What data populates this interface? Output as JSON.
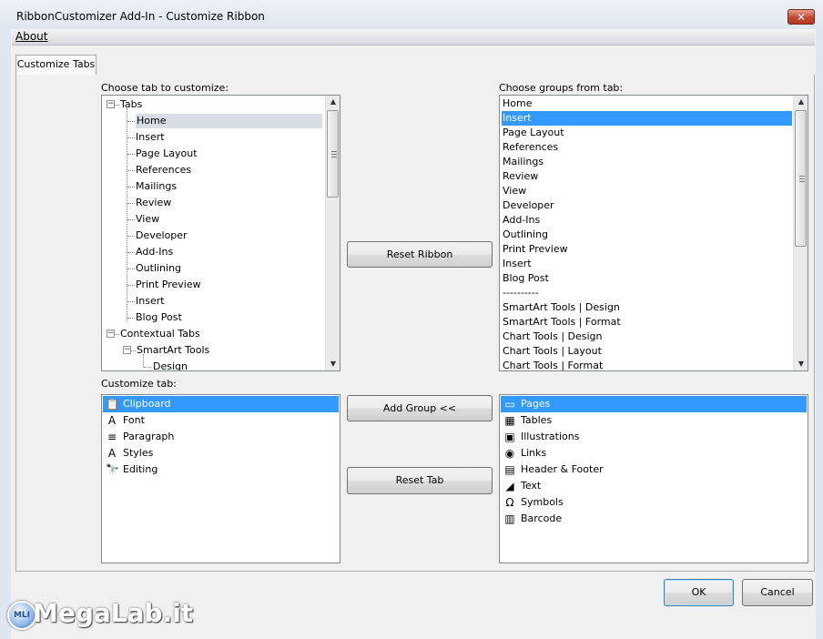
{
  "window": {
    "title": "RibbonCustomizer Add-In - Customize Ribbon",
    "close_glyph": "✕"
  },
  "menu": {
    "about": "About"
  },
  "tab": {
    "label": "Customize Tabs"
  },
  "labels": {
    "choose_tab": "Choose tab to customize:",
    "choose_groups": "Choose groups from tab:",
    "customize_tab": "Customize tab:"
  },
  "tree": {
    "root": "Tabs",
    "tabs": [
      "Home",
      "Insert",
      "Page Layout",
      "References",
      "Mailings",
      "Review",
      "View",
      "Developer",
      "Add-Ins",
      "Outlining",
      "Print Preview",
      "Insert",
      "Blog Post"
    ],
    "contextual": "Contextual Tabs",
    "smartart": "SmartArt Tools",
    "design": "Design",
    "selected": "Home"
  },
  "groups_from_tab": {
    "items": [
      "Home",
      "Insert",
      "Page Layout",
      "References",
      "Mailings",
      "Review",
      "View",
      "Developer",
      "Add-Ins",
      "Outlining",
      "Print Preview",
      "Insert",
      "Blog Post",
      "----------",
      "SmartArt Tools | Design",
      "SmartArt Tools | Format",
      "Chart Tools | Design",
      "Chart Tools | Layout",
      "Chart Tools | Format"
    ],
    "selected": "Insert"
  },
  "customize_list": {
    "items": [
      {
        "label": "Clipboard",
        "icon": "clipboard-icon",
        "glyph": "📋"
      },
      {
        "label": "Font",
        "icon": "font-icon",
        "glyph": "A"
      },
      {
        "label": "Paragraph",
        "icon": "paragraph-icon",
        "glyph": "≡"
      },
      {
        "label": "Styles",
        "icon": "styles-icon",
        "glyph": "A"
      },
      {
        "label": "Editing",
        "icon": "editing-icon",
        "glyph": "🔭"
      }
    ],
    "selected": "Clipboard"
  },
  "source_groups": {
    "items": [
      {
        "label": "Pages",
        "icon": "pages-icon",
        "glyph": "▭"
      },
      {
        "label": "Tables",
        "icon": "tables-icon",
        "glyph": "▦"
      },
      {
        "label": "Illustrations",
        "icon": "illustrations-icon",
        "glyph": "▣"
      },
      {
        "label": "Links",
        "icon": "links-icon",
        "glyph": "◉"
      },
      {
        "label": "Header & Footer",
        "icon": "header-footer-icon",
        "glyph": "▤"
      },
      {
        "label": "Text",
        "icon": "text-icon",
        "glyph": "◢"
      },
      {
        "label": "Symbols",
        "icon": "symbols-icon",
        "glyph": "Ω"
      },
      {
        "label": "Barcode",
        "icon": "barcode-icon",
        "glyph": "▥"
      }
    ],
    "selected": "Pages"
  },
  "buttons": {
    "reset_ribbon": "Reset Ribbon",
    "add_group": "Add Group <<",
    "reset_tab": "Reset Tab",
    "ok": "OK",
    "cancel": "Cancel"
  },
  "watermark": {
    "text": "MegaLab.it",
    "logo": "MLI"
  },
  "colors": {
    "selection": "#3399ff",
    "tree_selection": "#d6dde5"
  }
}
